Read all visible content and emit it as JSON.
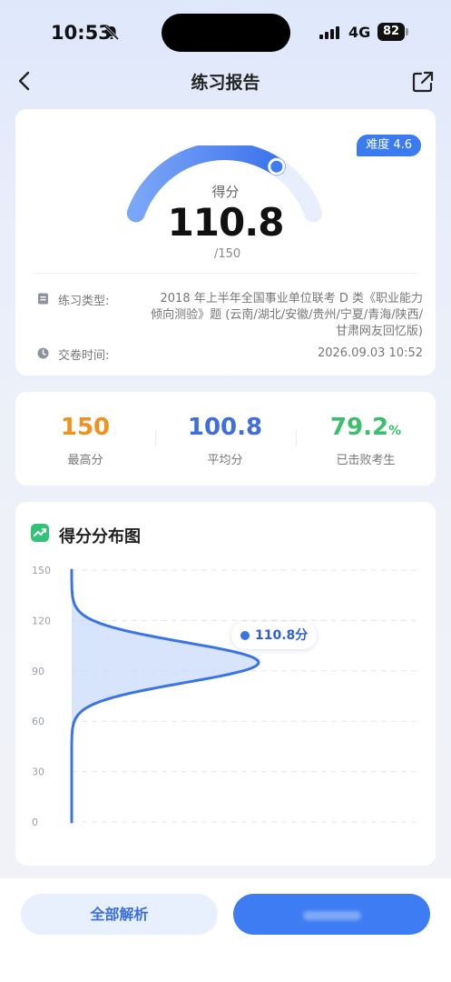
{
  "status": {
    "time": "10:53",
    "network": "4G",
    "battery": "82"
  },
  "nav": {
    "title": "练习报告"
  },
  "score": {
    "difficulty": "难度 4.6",
    "label": "得分",
    "value": "110.8",
    "total": "/150",
    "fraction": 0.7387
  },
  "info": {
    "type_label": "练习类型:",
    "type_value": "2018 年上半年全国事业单位联考 D 类《职业能力倾向测验》题 (云南/湖北/安徽/贵州/宁夏/青海/陕西/甘肃网友回忆版)",
    "time_label": "交卷时间:",
    "time_value": "2026.09.03 10:52"
  },
  "stats": {
    "max": {
      "value": "150",
      "label": "最高分"
    },
    "avg": {
      "value": "100.8",
      "label": "平均分"
    },
    "beat": {
      "value": "79.2",
      "unit": "%",
      "label": "已击败考生"
    }
  },
  "colors": {
    "accent": "#3d7cf2",
    "orange": "#f0921e",
    "blue": "#3f6fd8",
    "green": "#3cbf6a"
  },
  "chart": {
    "title": "得分分布图"
  },
  "chart_data": {
    "type": "area",
    "yticks": [
      "150",
      "120",
      "90",
      "60",
      "30",
      "0"
    ],
    "ylim": [
      0,
      150
    ],
    "marker": {
      "score": 110.8,
      "label": "110.8分"
    },
    "peak_score": 95,
    "spread": 12
  },
  "buttons": {
    "analysis": "全部解析"
  }
}
